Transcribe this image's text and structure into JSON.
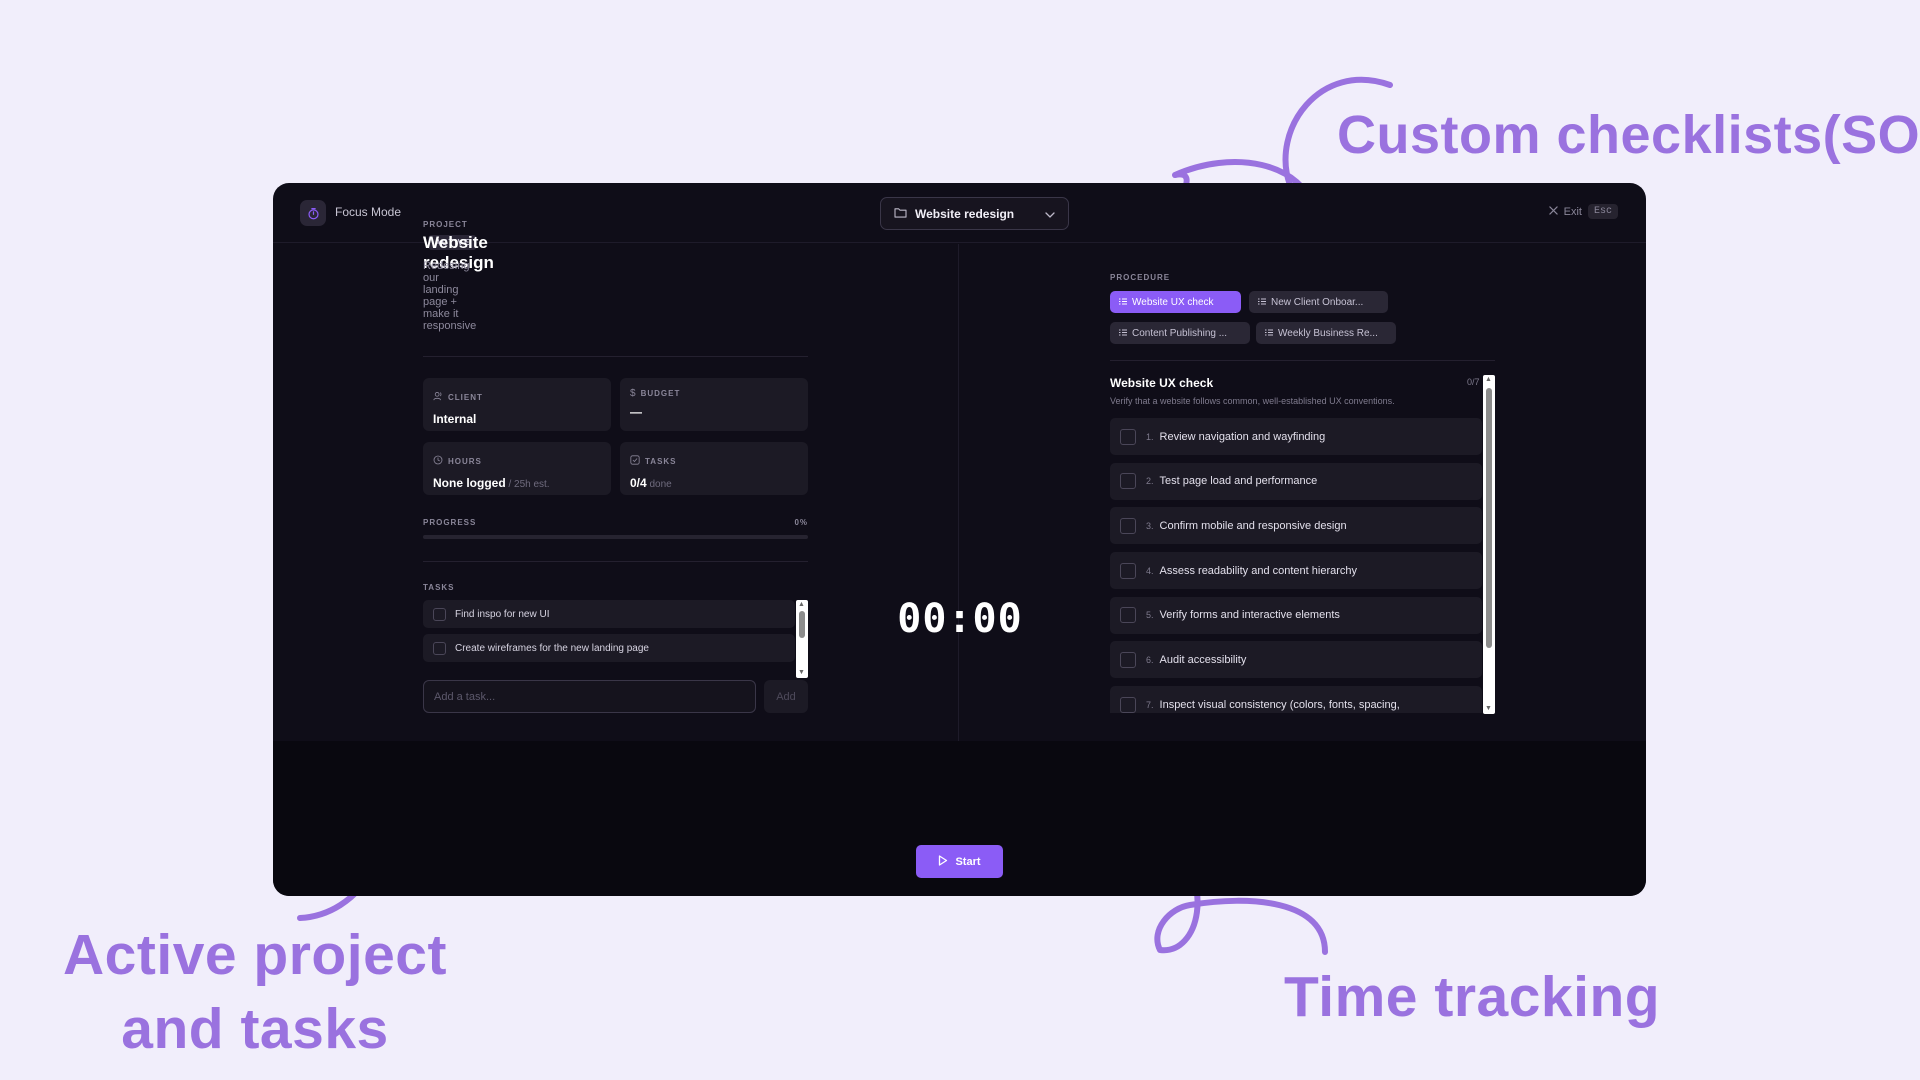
{
  "annotations": {
    "checklists": "Custom checklists(SOP)",
    "active_line1": "Active project",
    "active_line2": "and tasks",
    "time": "Time tracking"
  },
  "app": {
    "title": "Focus Mode",
    "selected_project": "Website redesign",
    "exit_label": "Exit",
    "exit_key": "Esc"
  },
  "project": {
    "section_label": "PROJECT",
    "status": "ACTIVE",
    "title": "Website redesign",
    "description": "Redesing our landing page + make it responsive"
  },
  "stats": {
    "client_label": "CLIENT",
    "client_value": "Internal",
    "budget_label": "BUDGET",
    "budget_value": "—",
    "hours_label": "HOURS",
    "hours_value": "None logged",
    "hours_sub": " / 25h est.",
    "tasks_label": "TASKS",
    "tasks_value": "0/4",
    "tasks_sub": " done"
  },
  "progress": {
    "label": "PROGRESS",
    "value_text": "0%",
    "value": 0
  },
  "tasks": {
    "label": "TASKS",
    "items": [
      {
        "label": "Find inspo for new UI"
      },
      {
        "label": "Create wireframes for the new landing page"
      }
    ],
    "add_placeholder": "Add a task...",
    "add_button": "Add"
  },
  "procedure": {
    "label": "PROCEDURE",
    "chips": [
      {
        "label": "Website UX check"
      },
      {
        "label": "New Client Onboar..."
      },
      {
        "label": "Content Publishing ..."
      },
      {
        "label": "Weekly Business Re..."
      }
    ]
  },
  "checklist": {
    "title": "Website UX check",
    "description": "Verify that a website follows common, well-established UX conventions.",
    "count": "0/7",
    "items": [
      {
        "num": "1.",
        "label": "Review navigation and wayfinding"
      },
      {
        "num": "2.",
        "label": "Test page load and performance"
      },
      {
        "num": "3.",
        "label": "Confirm mobile and responsive design"
      },
      {
        "num": "4.",
        "label": "Assess readability and content hierarchy"
      },
      {
        "num": "5.",
        "label": "Verify forms and interactive elements"
      },
      {
        "num": "6.",
        "label": "Audit accessibility"
      },
      {
        "num": "7.",
        "label": "Inspect visual consistency (colors, fonts, spacing,"
      }
    ]
  },
  "timer": {
    "display": "00:00",
    "start_label": "Start"
  },
  "colors": {
    "accent": "#8b5cf6",
    "annotation": "#9a72df",
    "background": "#f1eefb",
    "window": "#0f0d18"
  }
}
